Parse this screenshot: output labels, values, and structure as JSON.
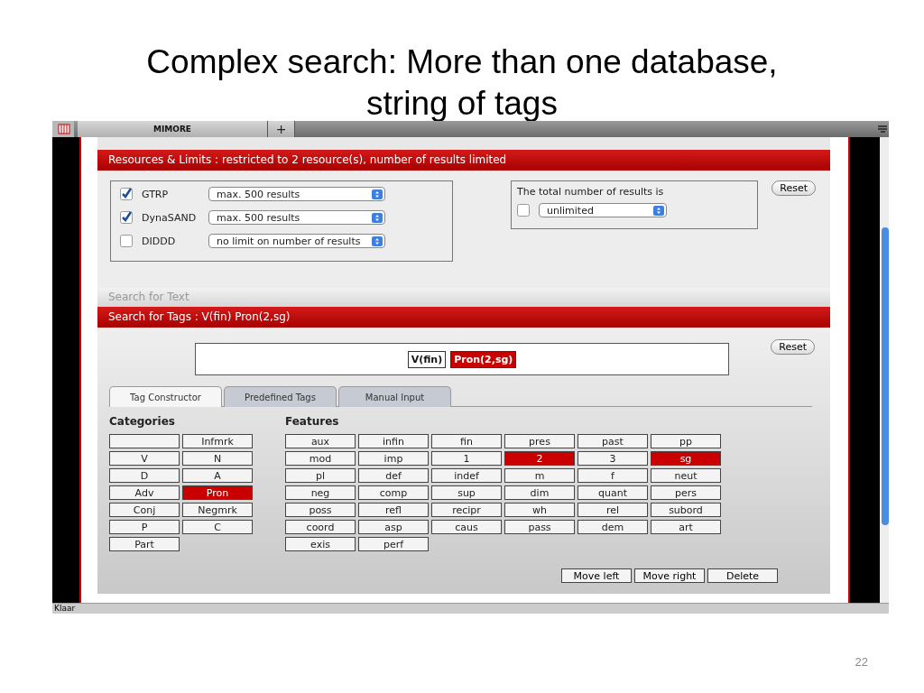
{
  "slide": {
    "title": "Complex search: More than one database, string of tags",
    "page_number": "22"
  },
  "browser": {
    "tab_title": "MIMORE",
    "new_tab": "+",
    "status": "Klaar"
  },
  "resources": {
    "header": "Resources & Limits : restricted to 2 resource(s), number of results limited",
    "items": [
      {
        "name": "GTRP",
        "checked": true,
        "limit": "max. 500 results"
      },
      {
        "name": "DynaSAND",
        "checked": true,
        "limit": "max. 500 results"
      },
      {
        "name": "DIDDD",
        "checked": false,
        "limit": "no limit on number of results"
      }
    ],
    "total": {
      "label": "The total number of results is",
      "checked": false,
      "value": "unlimited"
    },
    "reset": "Reset"
  },
  "text_search_header": "Search for Text",
  "tags": {
    "header": "Search for Tags : V(fin) Pron(2,sg)",
    "items": [
      {
        "label": "V(fin)",
        "selected": false
      },
      {
        "label": "Pron(2,sg)",
        "selected": true
      }
    ],
    "reset": "Reset",
    "tabs": [
      {
        "label": "Tag Constructor",
        "selected": true
      },
      {
        "label": "Predefined Tags",
        "selected": false
      },
      {
        "label": "Manual Input",
        "selected": false
      }
    ],
    "categories_title": "Categories",
    "categories": [
      {
        "selected": false
      },
      {
        "label": "Infmrk",
        "selected": false
      },
      {
        "label": "V",
        "selected": false
      },
      {
        "label": "N",
        "selected": false
      },
      {
        "label": "D",
        "selected": false
      },
      {
        "label": "A",
        "selected": false
      },
      {
        "label": "Adv",
        "selected": false
      },
      {
        "label": "Pron",
        "selected": true
      },
      {
        "label": "Conj",
        "selected": false
      },
      {
        "label": "Negmrk",
        "selected": false
      },
      {
        "label": "P",
        "selected": false
      },
      {
        "label": "C",
        "selected": false
      },
      {
        "label": "Part",
        "selected": false
      }
    ],
    "features_title": "Features",
    "features": [
      {
        "label": "aux",
        "selected": false
      },
      {
        "label": "infin",
        "selected": false
      },
      {
        "label": "fin",
        "selected": false
      },
      {
        "label": "pres",
        "selected": false
      },
      {
        "label": "past",
        "selected": false
      },
      {
        "label": "pp",
        "selected": false
      },
      {
        "label": "mod",
        "selected": false
      },
      {
        "label": "imp",
        "selected": false
      },
      {
        "label": "1",
        "selected": false
      },
      {
        "label": "2",
        "selected": true
      },
      {
        "label": "3",
        "selected": false
      },
      {
        "label": "sg",
        "selected": true
      },
      {
        "label": "pl",
        "selected": false
      },
      {
        "label": "def",
        "selected": false
      },
      {
        "label": "indef",
        "selected": false
      },
      {
        "label": "m",
        "selected": false
      },
      {
        "label": "f",
        "selected": false
      },
      {
        "label": "neut",
        "selected": false
      },
      {
        "label": "neg",
        "selected": false
      },
      {
        "label": "comp",
        "selected": false
      },
      {
        "label": "sup",
        "selected": false
      },
      {
        "label": "dim",
        "selected": false
      },
      {
        "label": "quant",
        "selected": false
      },
      {
        "label": "pers",
        "selected": false
      },
      {
        "label": "poss",
        "selected": false
      },
      {
        "label": "refl",
        "selected": false
      },
      {
        "label": "recipr",
        "selected": false
      },
      {
        "label": "wh",
        "selected": false
      },
      {
        "label": "rel",
        "selected": false
      },
      {
        "label": "subord",
        "selected": false
      },
      {
        "label": "coord",
        "selected": false
      },
      {
        "label": "asp",
        "selected": false
      },
      {
        "label": "caus",
        "selected": false
      },
      {
        "label": "pass",
        "selected": false
      },
      {
        "label": "dem",
        "selected": false
      },
      {
        "label": "art",
        "selected": false
      },
      {
        "label": "exis",
        "selected": false
      },
      {
        "label": "perf",
        "selected": false
      }
    ],
    "actions": [
      "Move left",
      "Move right",
      "Delete"
    ]
  }
}
